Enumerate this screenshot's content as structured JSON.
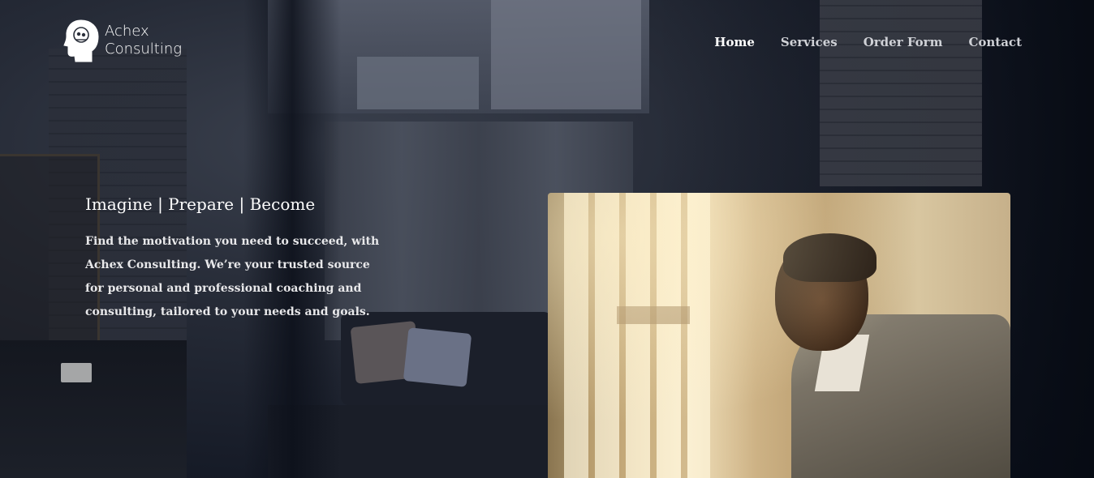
{
  "brand": {
    "line1": "Achex",
    "line2": "Consulting",
    "logo_icon": "head-silhouette-icon"
  },
  "nav": {
    "items": [
      {
        "label": "Home",
        "active": true
      },
      {
        "label": "Services",
        "active": false
      },
      {
        "label": "Order Form",
        "active": false
      },
      {
        "label": "Contact",
        "active": false
      }
    ]
  },
  "hero": {
    "tagline": "Imagine | Prepare | Become",
    "intro": "Find the motivation you need to succeed, with Achex Consulting. We’re your trusted source for personal and professional coaching and consulting, tailored to your needs and goals.",
    "photo_subject": "man-in-suit-looking-out-window-photo"
  },
  "colors": {
    "background": "#0d1220",
    "text": "#ffffff",
    "nav_inactive": "#cfd1d6"
  }
}
